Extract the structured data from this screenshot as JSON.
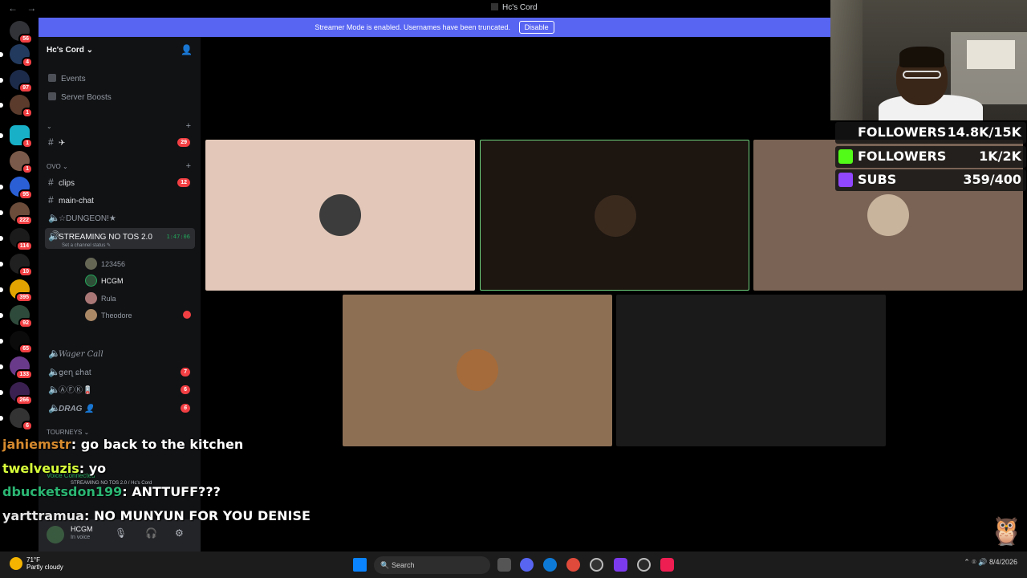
{
  "window": {
    "title": "Hc's Cord",
    "back": "←",
    "forward": "→"
  },
  "streamer_banner": {
    "text": "Streamer Mode is enabled. Usernames have been truncated.",
    "button": "Disable"
  },
  "guild_badges": [
    "56",
    "4",
    "97",
    "1",
    "1",
    "1",
    "95",
    "222",
    "114",
    "10",
    "395",
    "92",
    "65",
    "133",
    "266",
    "6"
  ],
  "server": {
    "name": "Hc's Cord ⌄"
  },
  "sidebar_top": [
    {
      "label": "Events",
      "icon": "calendar-icon"
    },
    {
      "label": "Server Boosts",
      "icon": "boost-icon"
    }
  ],
  "categories": {
    "cat1": "⌄",
    "ovo": "OVO ⌄",
    "tourneys": "TOURNEYS ⌄"
  },
  "channels": [
    {
      "name": "✈",
      "count": "29",
      "type": "text"
    },
    {
      "name": "clips",
      "count": "12",
      "type": "text"
    },
    {
      "name": "main-chat",
      "count": "",
      "type": "text"
    },
    {
      "name": "☆DUNGEON!★",
      "count": "",
      "type": "voice"
    },
    {
      "name": "Wager Call",
      "count": "",
      "type": "voice"
    },
    {
      "name": "ցeղ ɕհat",
      "count": "7",
      "type": "voice"
    },
    {
      "name": "ⒶⒻⓀ🪫",
      "count": "6",
      "type": "voice"
    },
    {
      "name": "DRAG 👤",
      "count": "6",
      "type": "voice"
    }
  ],
  "active_voice": {
    "name": "STREAMING NO TOS 2.0",
    "status": "Set a channel status ✎",
    "timer": "1:47:06"
  },
  "voice_users": [
    "123456",
    "HCGM",
    "Rula",
    "Theodore"
  ],
  "voice_panel": {
    "status": "Voice Connected",
    "channel": "STREAMING NO TOS 2.0 / Hc's Cord"
  },
  "user_panel": {
    "name": "HCGM",
    "status": "In voice"
  },
  "overlay": {
    "goals": [
      {
        "label": "FOLLOWERS",
        "value": "14.8K/15K",
        "icon": "tiktok-icon",
        "color": "#000000"
      },
      {
        "label": "FOLLOWERS",
        "value": "1K/2K",
        "icon": "kick-icon",
        "color": "#53fc18"
      },
      {
        "label": "SUBS",
        "value": "359/400",
        "icon": "twitch-icon",
        "color": "#9146ff"
      }
    ],
    "chat": [
      {
        "user": "jahiemstr",
        "message": ": go back to the kitchen",
        "color": "#d68a2e"
      },
      {
        "user": "twelveuzis",
        "message": ": yo",
        "color": "#d7ff3a"
      },
      {
        "user": "dbucketsdon199",
        "message": ": ANTTUFF???",
        "color": "#2bb673"
      },
      {
        "user": "yarttramua",
        "message": ": NO MUNYUN FOR YOU DENISE",
        "color": "#e6e6e6"
      }
    ]
  },
  "taskbar": {
    "weather_temp": "71°F",
    "weather_desc": "Partly cloudy",
    "search_placeholder": "Search",
    "date": "8/4/2026"
  },
  "colors": {
    "accent": "#5865f2",
    "speaking": "#23a55a",
    "badge": "#f23f43"
  }
}
